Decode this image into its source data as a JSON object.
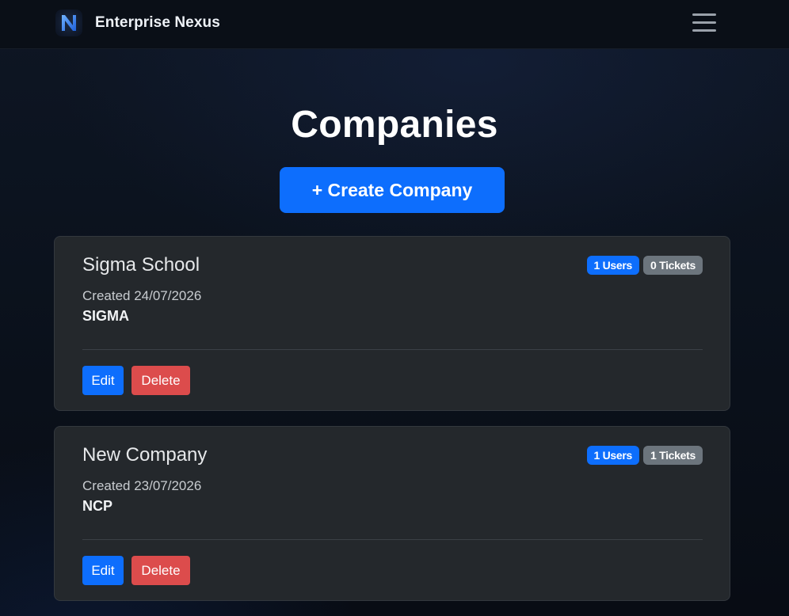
{
  "app": {
    "name": "Enterprise Nexus",
    "logo_letter": "N"
  },
  "page": {
    "title": "Companies",
    "create_label": "+ Create Company"
  },
  "colors": {
    "primary": "#0d6efd",
    "secondary": "#6c757d",
    "danger": "#dc4c4c",
    "card_bg": "#24282c",
    "page_bg": "#0b1018"
  },
  "icons": {
    "menu": "hamburger-icon",
    "logo": "nexus-logo-icon"
  },
  "companies": [
    {
      "name": "Sigma School",
      "created": "Created 24/07/2026",
      "code": "SIGMA",
      "users_badge": "1 Users",
      "tickets_badge": "0 Tickets",
      "edit_label": "Edit",
      "delete_label": "Delete"
    },
    {
      "name": "New Company",
      "created": "Created 23/07/2026",
      "code": "NCP",
      "users_badge": "1 Users",
      "tickets_badge": "1 Tickets",
      "edit_label": "Edit",
      "delete_label": "Delete"
    }
  ]
}
